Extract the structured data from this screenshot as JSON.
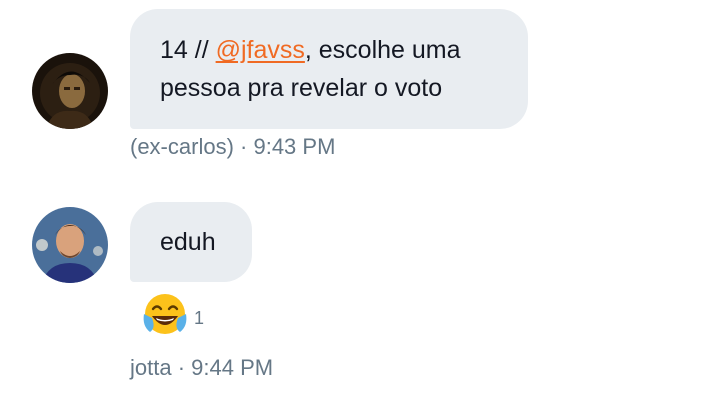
{
  "messages": [
    {
      "text_prefix": "14 // ",
      "mention": "@jfavss",
      "text_suffix": ", escolhe uma pessoa pra revelar o voto",
      "sender": "(ex-carlos)",
      "separator": " · ",
      "time": "9:43 PM"
    },
    {
      "text": "eduh",
      "sender": "jotta",
      "separator": " · ",
      "time": "9:44 PM",
      "reaction": {
        "icon": "face-with-tears-of-joy-icon",
        "count": "1"
      }
    }
  ],
  "colors": {
    "bubble": "#e9edf1",
    "mention": "#f06a23",
    "meta": "#657786"
  }
}
